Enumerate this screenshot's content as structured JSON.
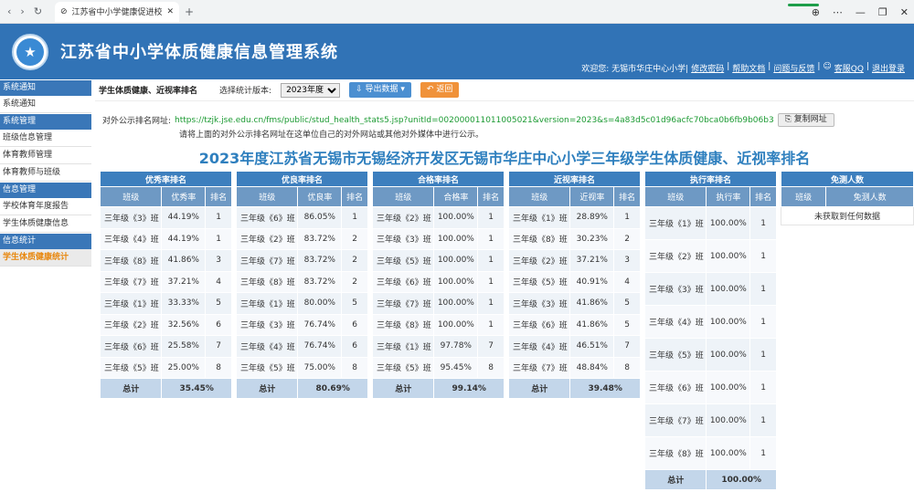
{
  "browser": {
    "tab_title": "江苏省中小学健康促进校管理",
    "close": "✕",
    "back": "‹",
    "forward": "›",
    "reload": "↻",
    "newtab": "+"
  },
  "banner": {
    "title": "江苏省中小学体质健康信息管理系统",
    "welcome": "欢迎您: 无锡市华庄中心小学|",
    "links": [
      "修改密码",
      "帮助文档",
      "问题与反馈"
    ],
    "qq": "客服QQ",
    "logout": "退出登录",
    "sep": "|"
  },
  "sidebar": [
    {
      "title": "系统通知",
      "items": [
        {
          "label": "系统通知",
          "active": false
        }
      ]
    },
    {
      "title": "系统管理",
      "items": [
        {
          "label": "班级信息管理",
          "active": false
        },
        {
          "label": "体育教师管理",
          "active": false
        },
        {
          "label": "体育教师与班级",
          "active": false
        }
      ]
    },
    {
      "title": "信息管理",
      "items": [
        {
          "label": "学校体育年度报告",
          "active": false
        },
        {
          "label": "学生体质健康信息",
          "active": false
        }
      ]
    },
    {
      "title": "信息统计",
      "items": [
        {
          "label": "学生体质健康统计",
          "active": true
        }
      ]
    }
  ],
  "toolbar": {
    "page_title": "学生体质健康、近视率排名",
    "version_label": "选择统计版本:",
    "version_value": "2023年度",
    "export": "导出数据",
    "back": "返回"
  },
  "share": {
    "label": "对外公示排名网址:",
    "url": "https://tzjk.jse.edu.cn/fms/public/stud_health_stats5.jsp?unitId=002000011011005021&version=2023&s=4a83d5c01d96acfc70bca0b6fb9b06b3",
    "copy": "复制网址",
    "note": "请将上面的对外公示排名网址在这单位自己的对外网站或其他对外媒体中进行公示。"
  },
  "heading": "2023年度江苏省无锡市无锡经济开发区无锡市华庄中心小学三年级学生体质健康、近视率排名",
  "tables": [
    {
      "title": "优秀率排名",
      "cols": [
        "班级",
        "优秀率",
        "排名"
      ],
      "rows": [
        [
          "三年级《3》班",
          "44.19%",
          "1"
        ],
        [
          "三年级《4》班",
          "44.19%",
          "1"
        ],
        [
          "三年级《8》班",
          "41.86%",
          "3"
        ],
        [
          "三年级《7》班",
          "37.21%",
          "4"
        ],
        [
          "三年级《1》班",
          "33.33%",
          "5"
        ],
        [
          "三年级《2》班",
          "32.56%",
          "6"
        ],
        [
          "三年级《6》班",
          "25.58%",
          "7"
        ],
        [
          "三年级《5》班",
          "25.00%",
          "8"
        ]
      ],
      "total_label": "总计",
      "total": "35.45%"
    },
    {
      "title": "优良率排名",
      "cols": [
        "班级",
        "优良率",
        "排名"
      ],
      "rows": [
        [
          "三年级《6》班",
          "86.05%",
          "1"
        ],
        [
          "三年级《2》班",
          "83.72%",
          "2"
        ],
        [
          "三年级《7》班",
          "83.72%",
          "2"
        ],
        [
          "三年级《8》班",
          "83.72%",
          "2"
        ],
        [
          "三年级《1》班",
          "80.00%",
          "5"
        ],
        [
          "三年级《3》班",
          "76.74%",
          "6"
        ],
        [
          "三年级《4》班",
          "76.74%",
          "6"
        ],
        [
          "三年级《5》班",
          "75.00%",
          "8"
        ]
      ],
      "total_label": "总计",
      "total": "80.69%"
    },
    {
      "title": "合格率排名",
      "cols": [
        "班级",
        "合格率",
        "排名"
      ],
      "rows": [
        [
          "三年级《2》班",
          "100.00%",
          "1"
        ],
        [
          "三年级《3》班",
          "100.00%",
          "1"
        ],
        [
          "三年级《5》班",
          "100.00%",
          "1"
        ],
        [
          "三年级《6》班",
          "100.00%",
          "1"
        ],
        [
          "三年级《7》班",
          "100.00%",
          "1"
        ],
        [
          "三年级《8》班",
          "100.00%",
          "1"
        ],
        [
          "三年级《1》班",
          "97.78%",
          "7"
        ],
        [
          "三年级《5》班",
          "95.45%",
          "8"
        ]
      ],
      "total_label": "总计",
      "total": "99.14%"
    },
    {
      "title": "近视率排名",
      "cols": [
        "班级",
        "近视率",
        "排名"
      ],
      "rows": [
        [
          "三年级《1》班",
          "28.89%",
          "1"
        ],
        [
          "三年级《8》班",
          "30.23%",
          "2"
        ],
        [
          "三年级《2》班",
          "37.21%",
          "3"
        ],
        [
          "三年级《5》班",
          "40.91%",
          "4"
        ],
        [
          "三年级《3》班",
          "41.86%",
          "5"
        ],
        [
          "三年级《6》班",
          "41.86%",
          "5"
        ],
        [
          "三年级《4》班",
          "46.51%",
          "7"
        ],
        [
          "三年级《7》班",
          "48.84%",
          "8"
        ]
      ],
      "total_label": "总计",
      "total": "39.48%"
    },
    {
      "title": "执行率排名",
      "cols": [
        "班级",
        "执行率",
        "排名"
      ],
      "rows": [
        [
          "三年级《1》班",
          "100.00%",
          "1"
        ],
        [
          "三年级《2》班",
          "100.00%",
          "1"
        ],
        [
          "三年级《3》班",
          "100.00%",
          "1"
        ],
        [
          "三年级《4》班",
          "100.00%",
          "1"
        ],
        [
          "三年级《5》班",
          "100.00%",
          "1"
        ],
        [
          "三年级《6》班",
          "100.00%",
          "1"
        ],
        [
          "三年级《7》班",
          "100.00%",
          "1"
        ],
        [
          "三年级《8》班",
          "100.00%",
          "1"
        ]
      ],
      "total_label": "总计",
      "total": "100.00%"
    }
  ],
  "exempt": {
    "title": "免测人数",
    "cols": [
      "班级",
      "免测人数"
    ],
    "empty": "未获取到任何数据"
  }
}
